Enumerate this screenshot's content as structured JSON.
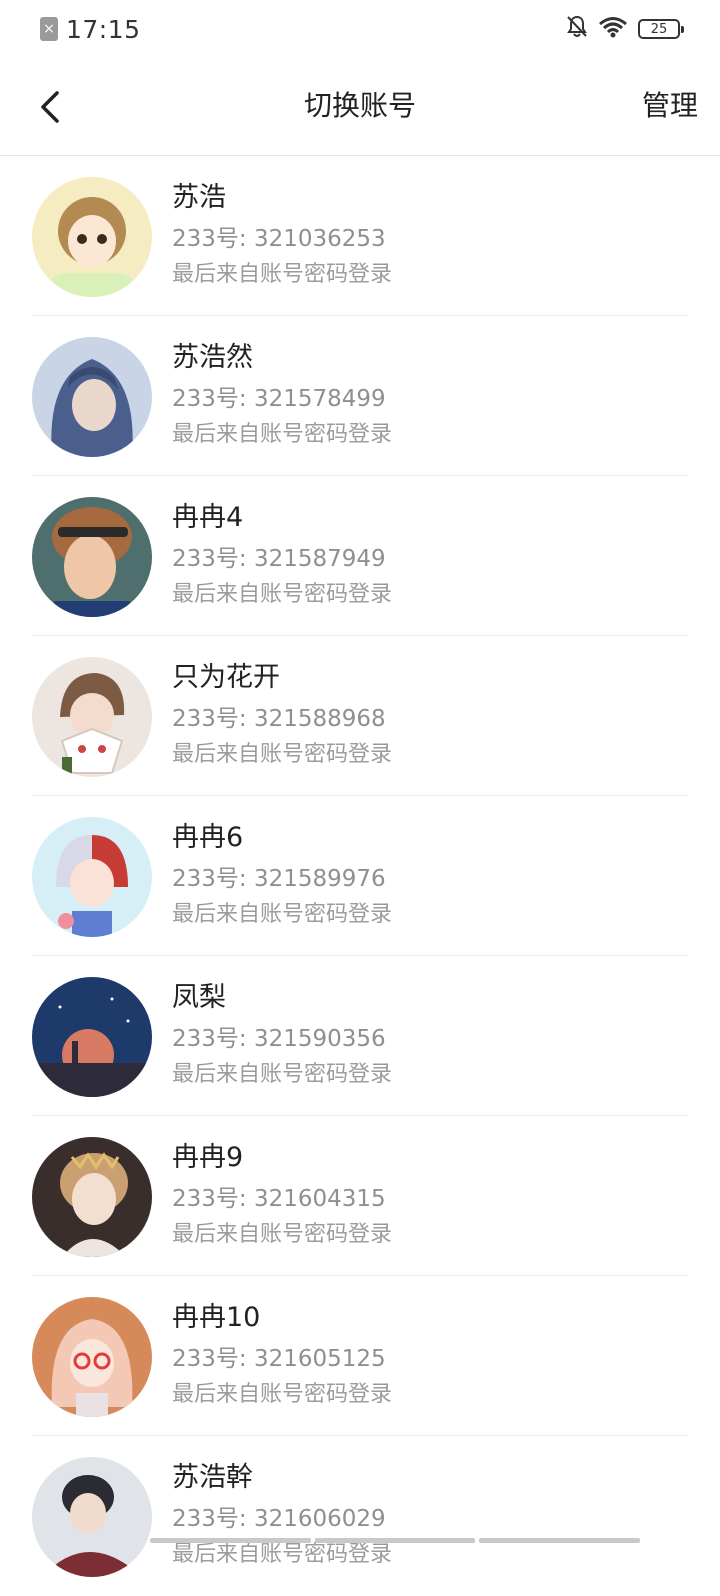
{
  "status_bar": {
    "time": "17:15",
    "battery": "25",
    "sim_icon": "sim-error-icon",
    "mute_icon": "bell-muted-icon",
    "wifi_icon": "wifi-icon"
  },
  "nav": {
    "title": "切换账号",
    "manage_label": "管理",
    "back_icon": "chevron-left-icon"
  },
  "accounts": [
    {
      "name": "苏浩",
      "id": "233号: 321036253",
      "login": "最后来自账号密码登录",
      "avatar_colors": [
        "#f6ecc2",
        "#b38a52",
        "#d9f0b8"
      ]
    },
    {
      "name": "苏浩然",
      "id": "233号: 321578499",
      "login": "最后来自账号密码登录",
      "avatar_colors": [
        "#c9d4e6",
        "#4b5f8d",
        "#e9d7cb"
      ]
    },
    {
      "name": "冉冉4",
      "id": "233号: 321587949",
      "login": "最后来自账号密码登录",
      "avatar_colors": [
        "#4f6e6e",
        "#a56a3f",
        "#f0c7a6"
      ]
    },
    {
      "name": "只为花开",
      "id": "233号: 321588968",
      "login": "最后来自账号密码登录",
      "avatar_colors": [
        "#ece5e0",
        "#7d5a44",
        "#f3dccd"
      ]
    },
    {
      "name": "冉冉6",
      "id": "233号: 321589976",
      "login": "最后来自账号密码登录",
      "avatar_colors": [
        "#d6eef6",
        "#d8d8e6",
        "#c63c35"
      ]
    },
    {
      "name": "凤梨",
      "id": "233号: 321590356",
      "login": "最后来自账号密码登录",
      "avatar_colors": [
        "#1e3a6a",
        "#d77a63",
        "#2d2b3a"
      ]
    },
    {
      "name": "冉冉9",
      "id": "233号: 321604315",
      "login": "最后来自账号密码登录",
      "avatar_colors": [
        "#3a2e2c",
        "#caa072",
        "#ece6df"
      ]
    },
    {
      "name": "冉冉10",
      "id": "233号: 321605125",
      "login": "最后来自账号密码登录",
      "avatar_colors": [
        "#d68a5a",
        "#f3c8b5",
        "#e23b3b"
      ]
    },
    {
      "name": "苏浩幹",
      "id": "233号: 321606029",
      "login": "最后来自账号密码登录",
      "avatar_colors": [
        "#e0e3e8",
        "#2b2b36",
        "#7c2e34"
      ]
    }
  ]
}
